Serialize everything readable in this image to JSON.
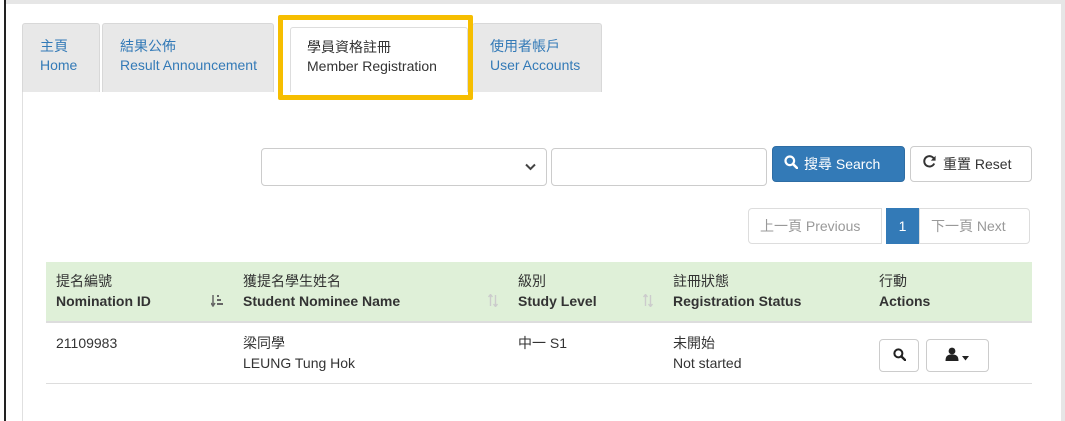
{
  "tabs": [
    {
      "zh": "主頁",
      "en": "Home"
    },
    {
      "zh": "結果公佈",
      "en": "Result Announcement"
    },
    {
      "zh": "學員資格註冊",
      "en": "Member Registration"
    },
    {
      "zh": "使用者帳戶",
      "en": "User Accounts"
    }
  ],
  "active_tab": "Member Registration",
  "search": {
    "select_value": "",
    "input_value": "",
    "search_label": "搜尋 Search",
    "reset_label": "重置 Reset"
  },
  "pagination": {
    "previous": "上一頁 Previous",
    "current": "1",
    "next": "下一頁 Next"
  },
  "table": {
    "headers": [
      {
        "zh": "提名編號",
        "en": "Nomination ID"
      },
      {
        "zh": "獲提名學生姓名",
        "en": "Student Nominee Name"
      },
      {
        "zh": "級別",
        "en": "Study Level"
      },
      {
        "zh": "註冊狀態",
        "en": "Registration Status"
      },
      {
        "zh": "行動",
        "en": "Actions"
      }
    ],
    "rows": [
      {
        "id": "21109983",
        "name_zh": "梁同學",
        "name_en": "LEUNG Tung Hok",
        "level": "中一 S1",
        "status_zh": "未開始",
        "status_en": "Not started"
      }
    ]
  },
  "colors": {
    "primary": "#337ab7",
    "header_bg": "#dff0d8",
    "highlight": "#f6be00",
    "tab_bg": "#e8e8e8"
  },
  "icons": {
    "search": "search-icon",
    "reset": "refresh-icon",
    "view": "search-icon",
    "user_menu": "user-icon"
  }
}
